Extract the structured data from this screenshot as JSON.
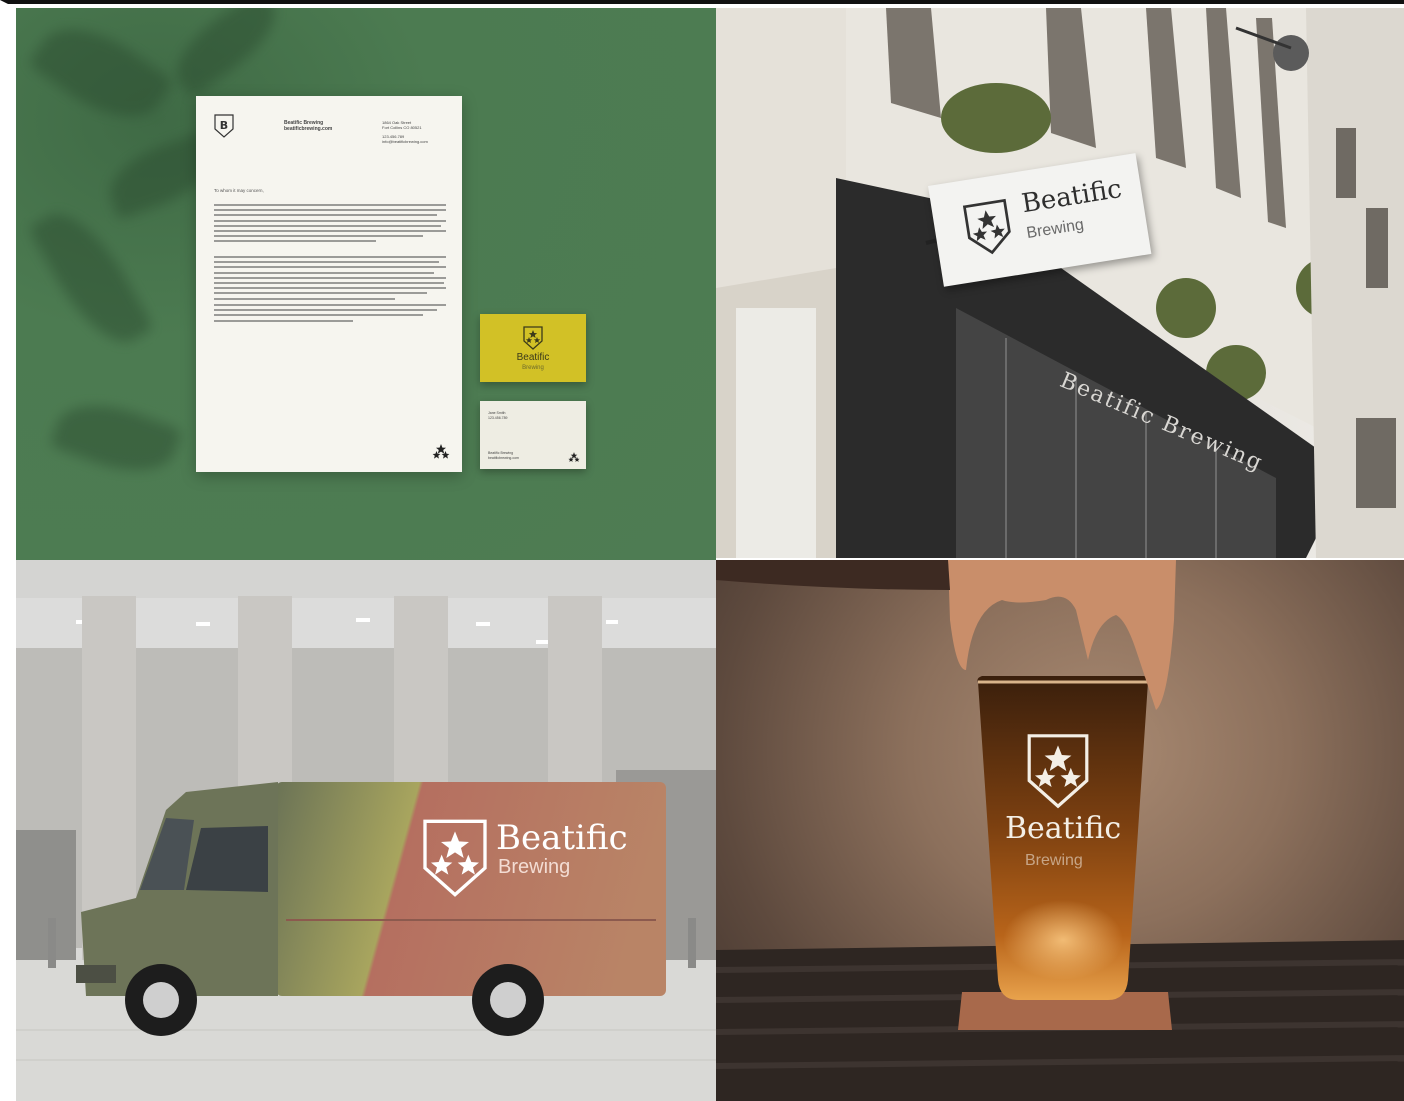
{
  "brand": {
    "name": "Beatific",
    "sub": "Brewing",
    "full": "Beatific Brewing",
    "initial": "B"
  },
  "stationery": {
    "company": "Beatific Brewing",
    "website": "beatificbrewing.com",
    "address_line1": "1864 Oak Street",
    "address_line2": "Fort Collins CO 80521",
    "phone": "123.456.789",
    "email": "info@beatificbrewing.com",
    "salutation": "To whom it may concern,",
    "card_name": "Jane Smith",
    "card_phone": "123.456.789"
  },
  "colors": {
    "green_backdrop": "#4e7c53",
    "card_yellow": "#d2c126",
    "truck_green": "#6d7458",
    "truck_rose": "#b26c5e",
    "beer_amber": "#6a3a12"
  }
}
